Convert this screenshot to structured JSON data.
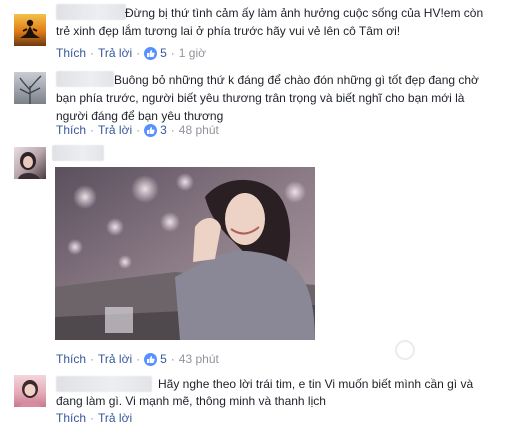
{
  "comments": [
    {
      "text": "Đừng bị thứ tình cảm ấy làm ảnh hưởng cuộc sống của HV!em còn trẻ xinh đẹp lắm tương lai ở phía trước hãy vui vẻ lên cô Tâm ơi!",
      "line1": "Đừng bị thứ tình cảm ấy làm ảnh hưởng cuộc sống của HV!em còn",
      "line2": "trẻ xinh đẹp lắm tương lai ở phía trước hãy vui vẻ lên cô Tâm ơi!",
      "like_label": "Thích",
      "reply_label": "Trả lời",
      "likes": "5",
      "time": "1 giờ"
    },
    {
      "line1": "Buông bỏ những thứ k đáng để chào đón những gì tốt đẹp đang chờ",
      "line2": "bạn phía trước, người biết yêu thương trân trọng và biết nghĩ cho bạn mới là",
      "line3": "người đáng để bạn yêu thương",
      "like_label": "Thích",
      "reply_label": "Trả lời",
      "likes": "3",
      "time": "48 phút"
    },
    {
      "like_label": "Thích",
      "reply_label": "Trả lời",
      "likes": "5",
      "time": "43 phút"
    },
    {
      "line1": "Hãy nghe theo lời trái tim, e tin Vi muốn biết mình cần gì và",
      "line2": "đang làm gì. Vi mạnh mẽ, thông minh và thanh lịch",
      "like_label": "Thích",
      "reply_label": "Trả lời"
    }
  ],
  "colors": {
    "link": "#365899",
    "meta": "#90949c",
    "like_badge": "#5890ff"
  },
  "icons": [
    "meditation-avatar-icon",
    "tree-avatar-icon",
    "like-icon"
  ]
}
